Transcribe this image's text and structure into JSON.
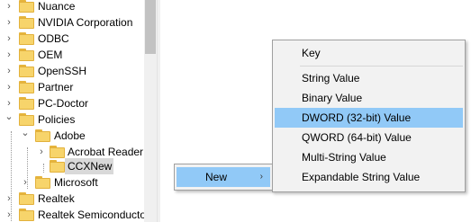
{
  "tree": {
    "items": [
      {
        "label": "Nuance"
      },
      {
        "label": "NVIDIA Corporation"
      },
      {
        "label": "ODBC"
      },
      {
        "label": "OEM"
      },
      {
        "label": "OpenSSH"
      },
      {
        "label": "Partner"
      },
      {
        "label": "PC-Doctor"
      },
      {
        "label": "Policies"
      },
      {
        "label": "Adobe"
      },
      {
        "label": "Acrobat Reader"
      },
      {
        "label": "CCXNew"
      },
      {
        "label": "Microsoft"
      },
      {
        "label": "Realtek"
      },
      {
        "label": "Realtek Semiconductor"
      }
    ],
    "chevron_collapsed": "›",
    "chevron_expanded": "⌄"
  },
  "context_menu": {
    "new_label": "New",
    "new_arrow": "›"
  },
  "submenu": {
    "items": [
      {
        "label": "Key"
      },
      {
        "label": "String Value"
      },
      {
        "label": "Binary Value"
      },
      {
        "label": "DWORD (32-bit) Value"
      },
      {
        "label": "QWORD (64-bit) Value"
      },
      {
        "label": "Multi-String Value"
      },
      {
        "label": "Expandable String Value"
      }
    ],
    "highlighted": "DWORD (32-bit) Value"
  },
  "colors": {
    "highlight": "#91c9f7",
    "folder": "#f7d46b",
    "selection": "#d9d9d9"
  }
}
